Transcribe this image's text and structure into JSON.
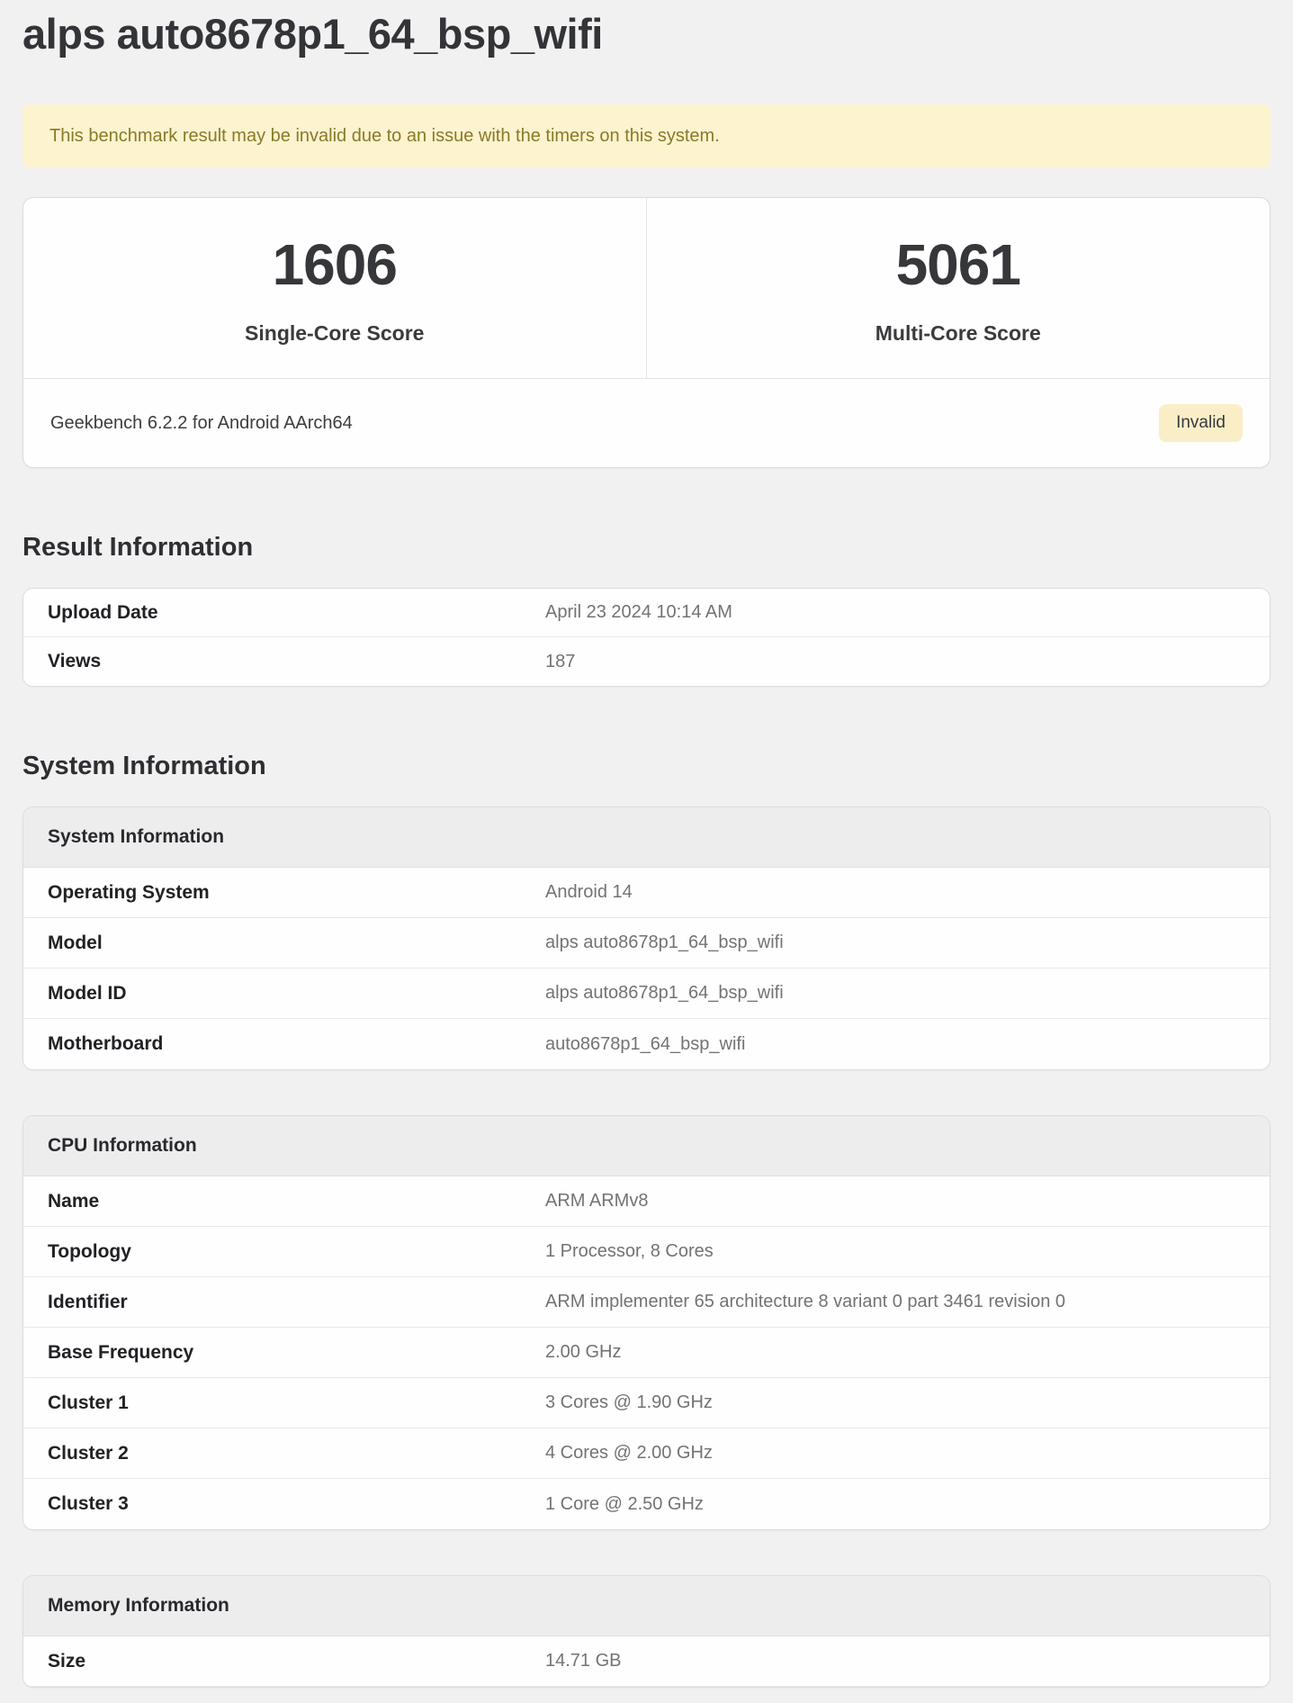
{
  "page": {
    "title": "alps auto8678p1_64_bsp_wifi"
  },
  "warning": {
    "text": "This benchmark result may be invalid due to an issue with the timers on this system."
  },
  "scores": {
    "single": {
      "value": "1606",
      "label": "Single-Core Score"
    },
    "multi": {
      "value": "5061",
      "label": "Multi-Core Score"
    },
    "footer": "Geekbench 6.2.2 for Android AArch64",
    "badge": "Invalid"
  },
  "result_information": {
    "heading": "Result Information",
    "rows": [
      {
        "label": "Upload Date",
        "value": "April 23 2024 10:14 AM"
      },
      {
        "label": "Views",
        "value": "187"
      }
    ]
  },
  "system_information": {
    "heading": "System Information",
    "groups": [
      {
        "header": "System Information",
        "rows": [
          {
            "label": "Operating System",
            "value": "Android 14"
          },
          {
            "label": "Model",
            "value": "alps auto8678p1_64_bsp_wifi"
          },
          {
            "label": "Model ID",
            "value": "alps auto8678p1_64_bsp_wifi"
          },
          {
            "label": "Motherboard",
            "value": "auto8678p1_64_bsp_wifi"
          }
        ]
      },
      {
        "header": "CPU Information",
        "rows": [
          {
            "label": "Name",
            "value": "ARM ARMv8"
          },
          {
            "label": "Topology",
            "value": "1 Processor, 8 Cores"
          },
          {
            "label": "Identifier",
            "value": "ARM implementer 65 architecture 8 variant 0 part 3461 revision 0"
          },
          {
            "label": "Base Frequency",
            "value": "2.00 GHz"
          },
          {
            "label": "Cluster 1",
            "value": "3 Cores @ 1.90 GHz"
          },
          {
            "label": "Cluster 2",
            "value": "4 Cores @ 2.00 GHz"
          },
          {
            "label": "Cluster 3",
            "value": "1 Core @ 2.50 GHz"
          }
        ]
      },
      {
        "header": "Memory Information",
        "rows": [
          {
            "label": "Size",
            "value": "14.71 GB"
          }
        ]
      }
    ]
  },
  "colors": {
    "page_background": "#f1f1f2",
    "card_background": "#fefefe",
    "card_border": "#dcdcde",
    "warning_background": "#fdf3cf",
    "warning_text": "#8a7a28",
    "badge_background": "#faeec7",
    "group_header_background": "#ededee",
    "label_text": "#212225",
    "value_text": "#737376"
  }
}
